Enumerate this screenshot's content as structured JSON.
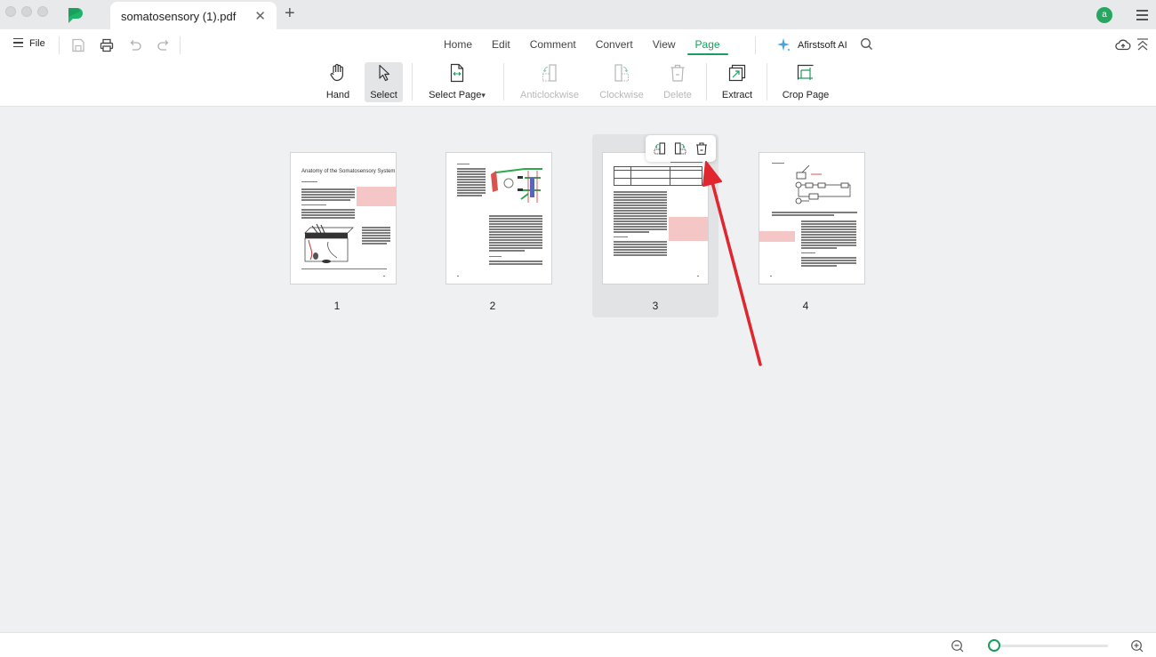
{
  "window": {
    "tab_title": "somatosensory (1).pdf",
    "avatar_initial": "a"
  },
  "toolbar": {
    "file_label": "File",
    "menu_tabs": [
      {
        "label": "Home",
        "active": false
      },
      {
        "label": "Edit",
        "active": false
      },
      {
        "label": "Comment",
        "active": false
      },
      {
        "label": "Convert",
        "active": false
      },
      {
        "label": "View",
        "active": false
      },
      {
        "label": "Page",
        "active": true
      }
    ],
    "ai_label": "Afirstsoft AI",
    "tools": [
      {
        "label": "Hand",
        "icon": "hand-icon",
        "state": "enabled"
      },
      {
        "label": "Select",
        "icon": "cursor-icon",
        "state": "selected"
      },
      {
        "label": "Select Page",
        "icon": "select-page-icon",
        "state": "enabled",
        "dropdown": true
      },
      {
        "label": "Anticlockwise",
        "icon": "rotate-anticlockwise-icon",
        "state": "disabled"
      },
      {
        "label": "Clockwise",
        "icon": "rotate-clockwise-icon",
        "state": "disabled"
      },
      {
        "label": "Delete",
        "icon": "trash-icon",
        "state": "disabled"
      },
      {
        "label": "Extract",
        "icon": "extract-icon",
        "state": "enabled"
      },
      {
        "label": "Crop Page",
        "icon": "crop-icon",
        "state": "enabled"
      }
    ],
    "dropdown_glyph": "▾"
  },
  "pages": [
    {
      "number": "1",
      "title": "Anatomy of the Somatosensory System",
      "selected": false
    },
    {
      "number": "2",
      "selected": false
    },
    {
      "number": "3",
      "selected": true
    },
    {
      "number": "4",
      "selected": false
    }
  ],
  "page_hover_tools": [
    "rotate-anticlockwise-icon",
    "rotate-clockwise-icon",
    "trash-icon"
  ],
  "annotation": {
    "type": "arrow",
    "color": "#e0262f",
    "points_to": "page-3-delete-button"
  },
  "status": {
    "zoom_fraction": 0.0
  },
  "colors": {
    "accent": "#1a9e5f",
    "highlight": "#f5c6c6"
  }
}
